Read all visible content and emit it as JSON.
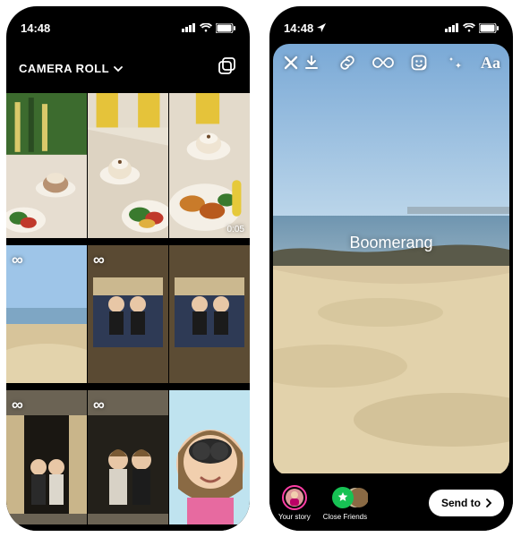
{
  "status": {
    "time": "14:48",
    "has_location_arrow_right": true
  },
  "left": {
    "album_title": "CAMERA ROLL",
    "grid": [
      {
        "boomerang": false,
        "duration": null
      },
      {
        "boomerang": false,
        "duration": null
      },
      {
        "boomerang": false,
        "duration": "0:05"
      },
      {
        "boomerang": true,
        "duration": null
      },
      {
        "boomerang": true,
        "duration": null
      },
      {
        "boomerang": false,
        "duration": null
      },
      {
        "boomerang": true,
        "duration": null
      },
      {
        "boomerang": true,
        "duration": null
      },
      {
        "boomerang": false,
        "duration": null
      }
    ]
  },
  "right": {
    "overlay_label": "Boomerang",
    "toolbar_text_glyph": "Aa",
    "share_targets": [
      {
        "label": "Your story"
      },
      {
        "label": "Close Friends"
      }
    ],
    "send_to_label": "Send to"
  }
}
